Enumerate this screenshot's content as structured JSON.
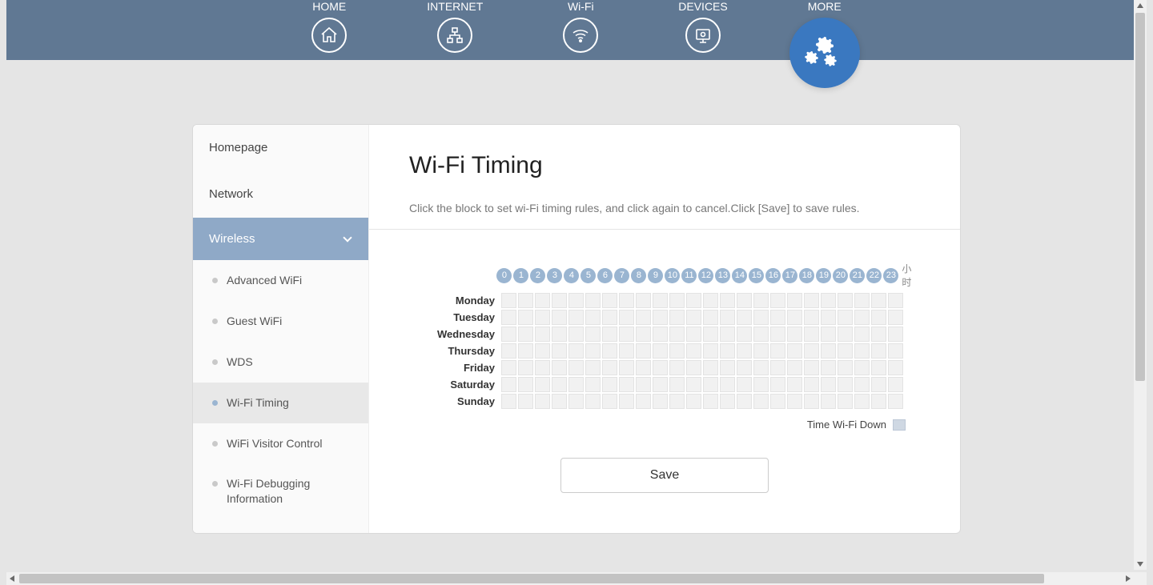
{
  "nav": {
    "home": "HOME",
    "internet": "INTERNET",
    "wifi": "Wi-Fi",
    "devices": "DEVICES",
    "more": "MORE"
  },
  "sidebar": {
    "homepage": "Homepage",
    "network": "Network",
    "wireless": "Wireless",
    "items": [
      "Advanced WiFi",
      "Guest WiFi",
      "WDS",
      "Wi-Fi Timing",
      "WiFi Visitor Control",
      "Wi-Fi Debugging Information"
    ]
  },
  "main": {
    "title": "Wi-Fi Timing",
    "hint": "Click the block to set wi-Fi timing rules, and click again to cancel.Click [Save] to save rules.",
    "hours": [
      "0",
      "1",
      "2",
      "3",
      "4",
      "5",
      "6",
      "7",
      "8",
      "9",
      "10",
      "11",
      "12",
      "13",
      "14",
      "15",
      "16",
      "17",
      "18",
      "19",
      "20",
      "21",
      "22",
      "23"
    ],
    "hour_unit": "小时",
    "days": [
      "Monday",
      "Tuesday",
      "Wednesday",
      "Thursday",
      "Friday",
      "Saturday",
      "Sunday"
    ],
    "legend": "Time Wi-Fi Down",
    "save": "Save"
  }
}
